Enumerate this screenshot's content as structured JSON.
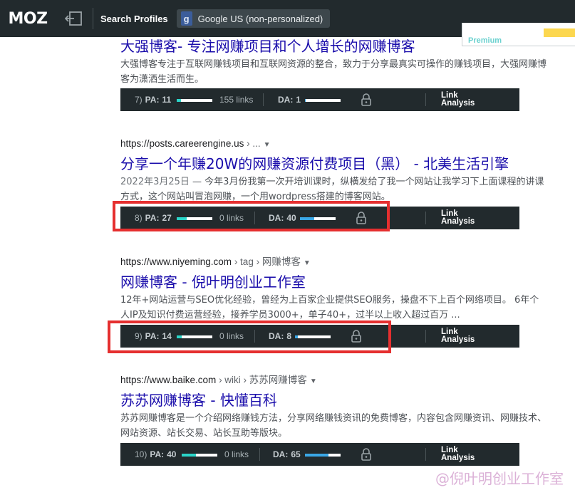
{
  "mozbar": {
    "logo": "MOZ",
    "search_profiles_label": "Search Profiles",
    "profile_icon_letter": "g",
    "profile": "Google US (non-personalized)",
    "premium": "Premium"
  },
  "results": [
    {
      "title": "大强博客- 专注网赚项目和个人增长的网赚博客",
      "snippet": "大强博客专注于互联网赚钱项目和互联网资源的整合，致力于分享最真实可操作的赚钱项目，大强网赚博客为潇洒生活而生。",
      "metrics": {
        "rank": "7)",
        "pa_label": "PA:",
        "pa": "11",
        "pa_value": 11,
        "links": "155 links",
        "da_label": "DA:",
        "da": "1",
        "da_value": 1,
        "link_analysis_line1": "Link",
        "link_analysis_line2": "Analysis"
      }
    },
    {
      "url": "https://posts.careerengine.us",
      "crumb": " › ...",
      "title": "分享一个年赚20W的网赚资源付费项目（黑） - 北美生活引擎",
      "date": "2022年3月25日",
      "snippet": " — 今年3月份我第一次开培训课时，纵横发给了我一个网站让我学习下上面课程的讲课方式，这个网站叫冒泡网赚，一个用wordpress搭建的博客网站。",
      "metrics": {
        "rank": "8)",
        "pa_label": "PA:",
        "pa": "27",
        "pa_value": 27,
        "links": "0 links",
        "da_label": "DA:",
        "da": "40",
        "da_value": 40,
        "link_analysis_line1": "Link",
        "link_analysis_line2": "Analysis"
      }
    },
    {
      "url": "https://www.niyeming.com",
      "crumb": " › tag › 网赚博客",
      "title": "网赚博客 - 倪叶明创业工作室",
      "snippet": "12年+网站运营与SEO优化经验，曾经为上百家企业提供SEO服务，操盘不下上百个网络项目。 6年个人IP及知识付费运营经验，接养学员3000+，单子40+，过半以上收入超过百万 ...",
      "metrics": {
        "rank": "9)",
        "pa_label": "PA:",
        "pa": "14",
        "pa_value": 14,
        "links": "0 links",
        "da_label": "DA:",
        "da": "8",
        "da_value": 8,
        "link_analysis_line1": "Link",
        "link_analysis_line2": "Analysis"
      }
    },
    {
      "url": "https://www.baike.com",
      "crumb": " › wiki › 苏苏网赚博客",
      "title": "苏苏网赚博客 - 快懂百科",
      "snippet": "苏苏网赚博客是一个介绍网络赚钱方法，分享网络赚钱资讯的免费博客，内容包含网赚资讯、网赚技术、网站资源、站长交易、站长互助等版块。",
      "metrics": {
        "rank": "10)",
        "pa_label": "PA:",
        "pa": "40",
        "pa_value": 40,
        "links": "0 links",
        "da_label": "DA:",
        "da": "65",
        "da_value": 65,
        "link_analysis_line1": "Link",
        "link_analysis_line2": "Analysis"
      }
    }
  ],
  "watermark": "@倪叶明创业工作室",
  "colors": {
    "title_link": "#1a0dab",
    "mozbar_bg": "#222a2d",
    "pa_fill": "#2bd4c8",
    "da_fill": "#3aa7e6",
    "highlight": "#e52f2f"
  }
}
